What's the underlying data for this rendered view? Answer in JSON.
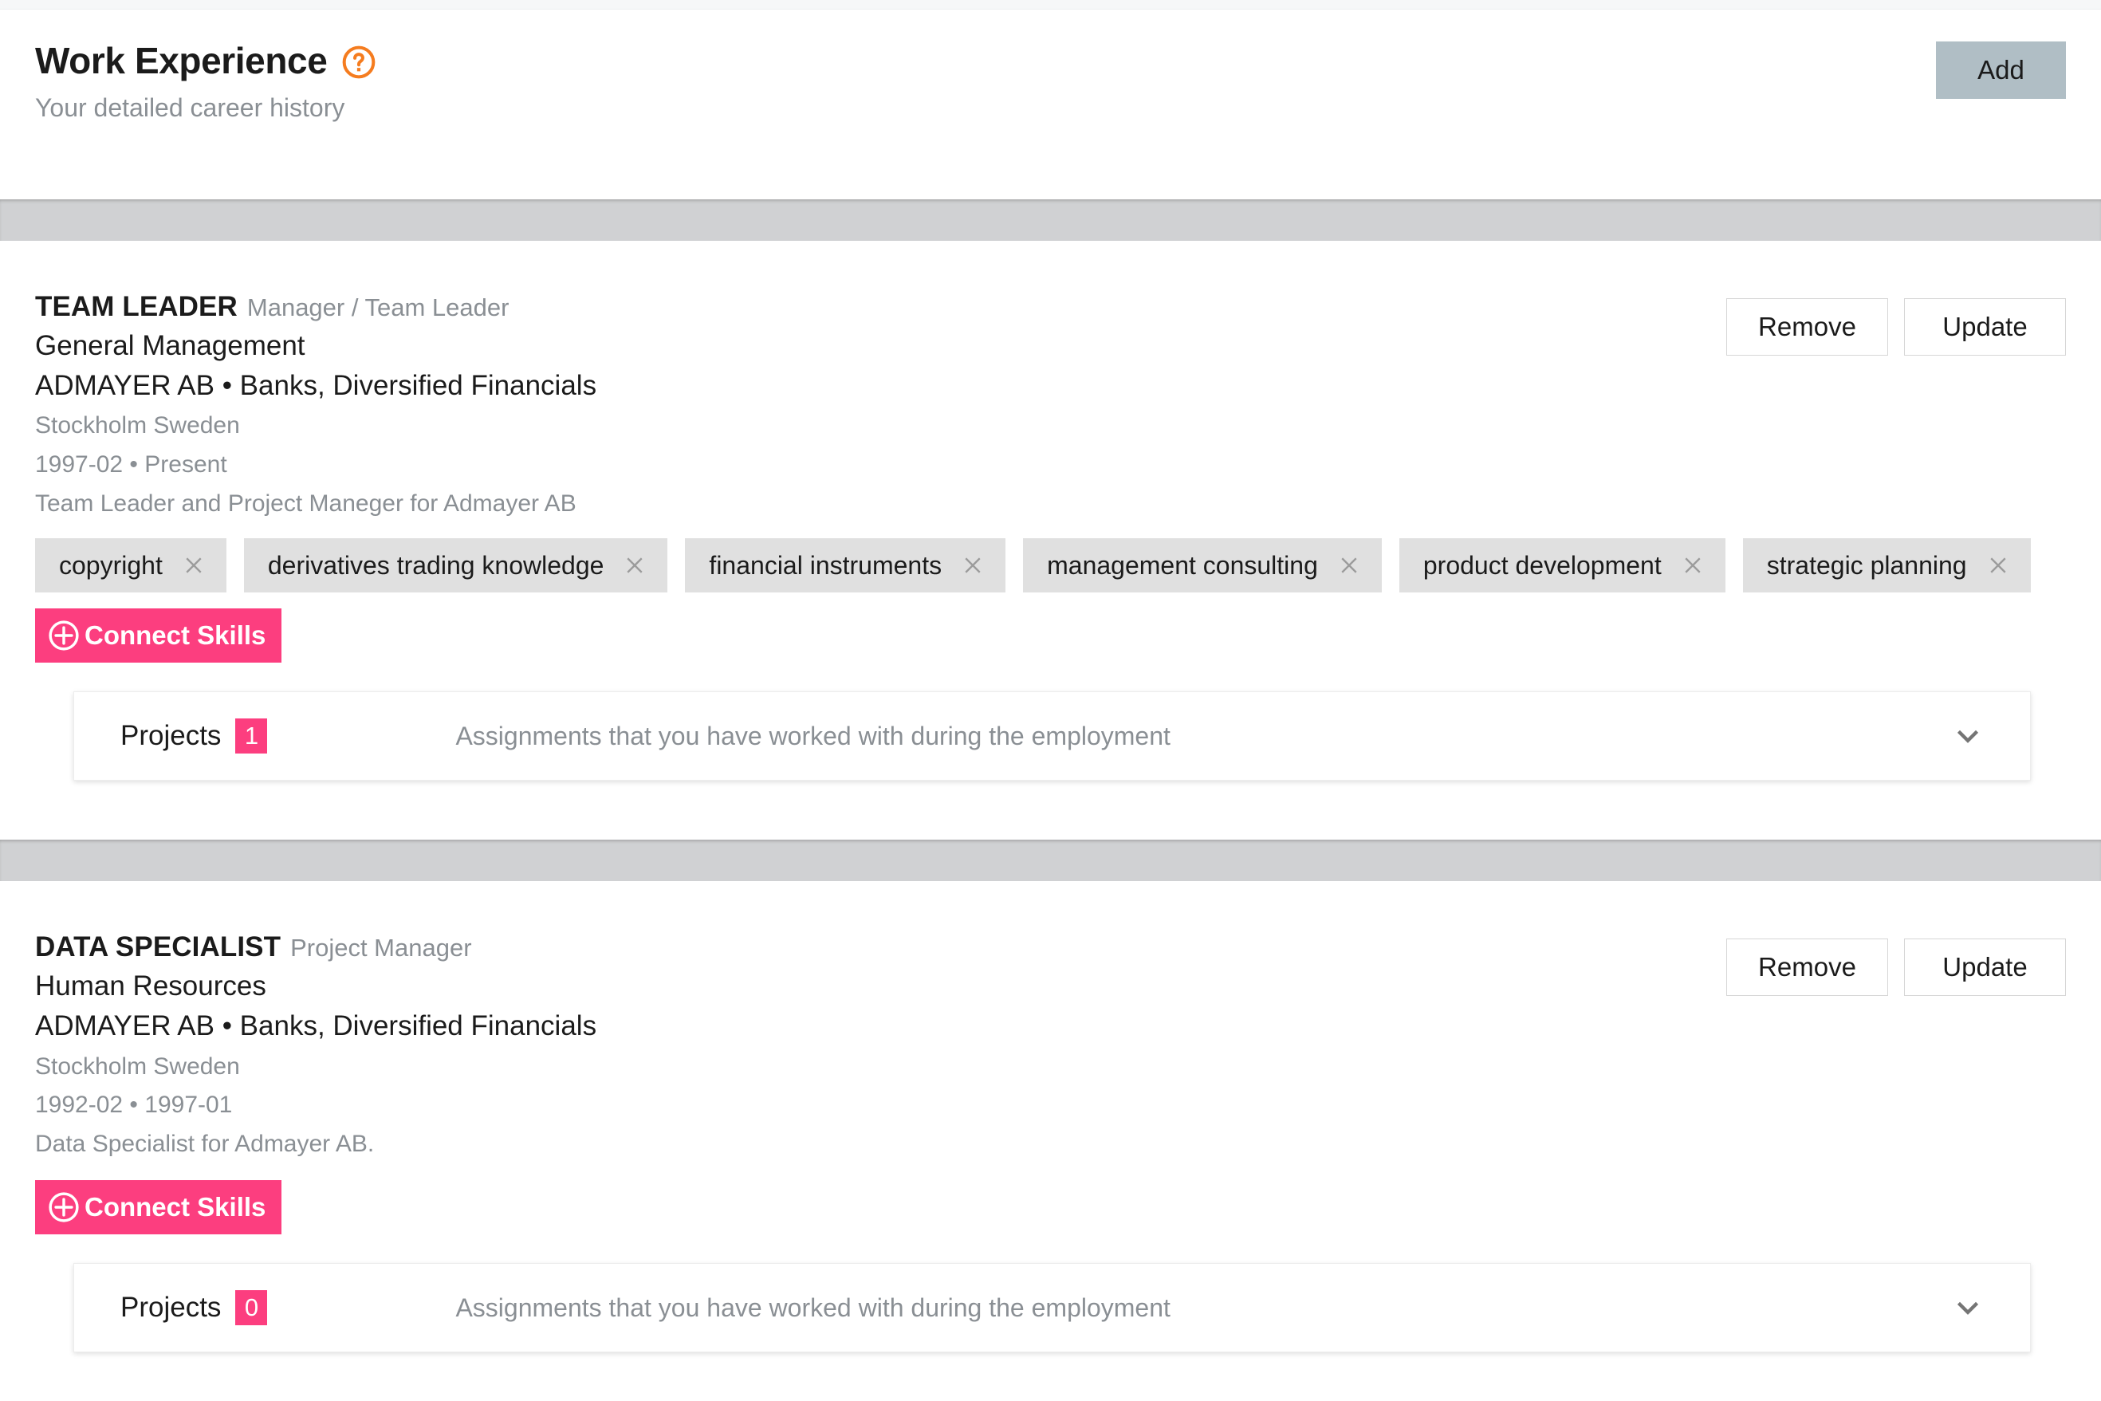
{
  "header": {
    "title": "Work Experience",
    "help_icon": "question-circle-icon",
    "subtitle": "Your detailed career history",
    "add_label": "Add",
    "add_bg": "#b0bec5"
  },
  "theme": {
    "accent_pink": "#fc3e7f",
    "help_orange": "#f57c1f",
    "band_gray": "#d0d1d3",
    "tag_gray": "#e0e0e0"
  },
  "entries": [
    {
      "role_title": "TEAM LEADER",
      "role_level": "Manager / Team Leader",
      "department": "General Management",
      "company": "ADMAYER AB • Banks, Diversified Financials",
      "location": "Stockholm Sweden",
      "dates": "1997-02 • Present",
      "description": "Team Leader and Project Maneger for Admayer AB",
      "remove_label": "Remove",
      "update_label": "Update",
      "connect_label": "Connect Skills",
      "tags": [
        "copyright",
        "derivatives trading knowledge",
        "financial instruments",
        "management consulting",
        "product development",
        "strategic planning"
      ],
      "projects": {
        "label": "Projects",
        "count": "1",
        "description": "Assignments that you have worked with during the employment",
        "chevron": "chevron-down-icon"
      }
    },
    {
      "role_title": "DATA SPECIALIST",
      "role_level": "Project Manager",
      "department": "Human Resources",
      "company": "ADMAYER AB • Banks, Diversified Financials",
      "location": "Stockholm Sweden",
      "dates": "1992-02 • 1997-01",
      "description": "Data Specialist for Admayer AB.",
      "remove_label": "Remove",
      "update_label": "Update",
      "connect_label": "Connect Skills",
      "tags": [],
      "projects": {
        "label": "Projects",
        "count": "0",
        "description": "Assignments that you have worked with during the employment",
        "chevron": "chevron-down-icon"
      }
    }
  ]
}
